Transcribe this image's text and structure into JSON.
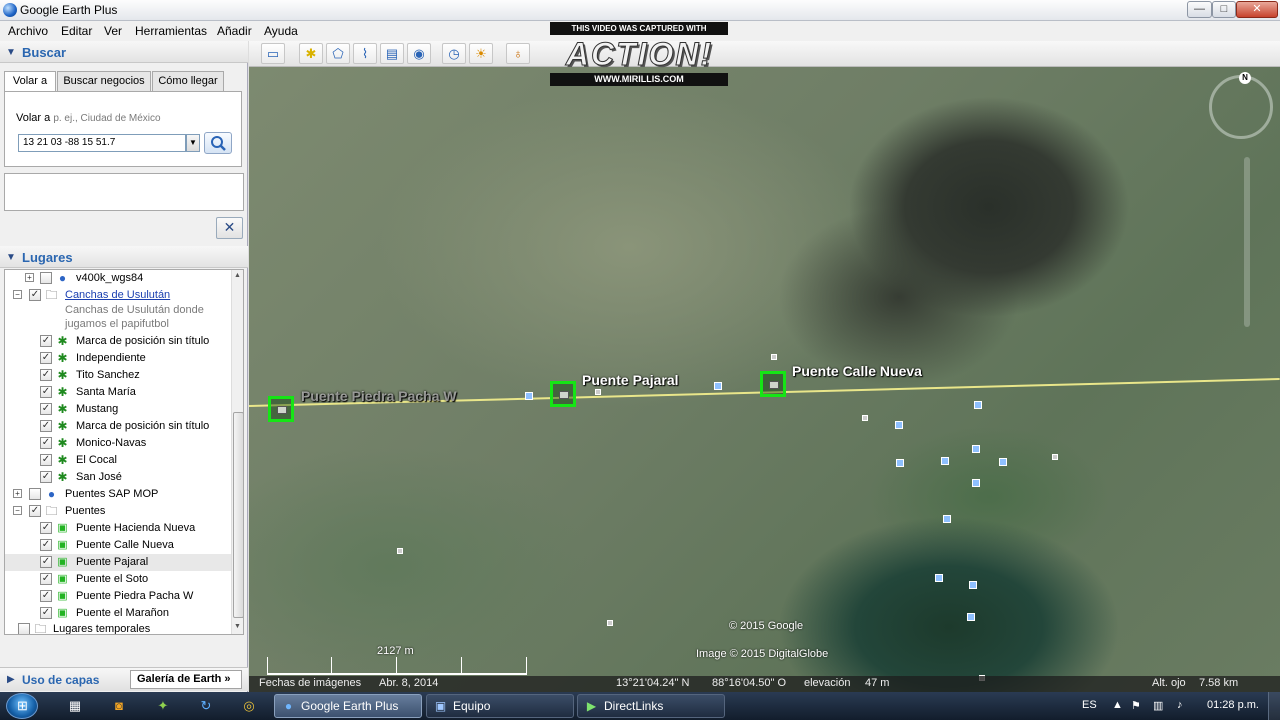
{
  "window": {
    "title": "Google Earth Plus",
    "buttons": {
      "minimize": "—",
      "maximize": "□",
      "close": "✕"
    }
  },
  "menu": [
    "Archivo",
    "Editar",
    "Ver",
    "Herramientas",
    "Añadir",
    "Ayuda"
  ],
  "search_panel": {
    "header": "Buscar",
    "tabs": [
      "Volar a",
      "Buscar negocios",
      "Cómo llegar"
    ],
    "fly_to_label": "Volar a",
    "placeholder_hint": "p. ej., Ciudad de México",
    "query_value": "13 21 03 -88 15 51.7",
    "close_label": "✕"
  },
  "places_panel": {
    "header": "Lugares",
    "items": [
      {
        "label": "v400k_wgs84",
        "icon": "globe-icon",
        "checked": false,
        "expander": "+",
        "indent": 1
      },
      {
        "label": "Canchas de Usulután",
        "icon": "folder-icon",
        "checked": true,
        "expander": "-",
        "indent": 0,
        "link": true
      },
      {
        "label": "Marca de posición sin título",
        "icon": "placemark-icon",
        "checked": true,
        "indent": 2
      },
      {
        "label": "Independiente",
        "icon": "placemark-icon",
        "checked": true,
        "indent": 2
      },
      {
        "label": "Tito Sanchez",
        "icon": "placemark-icon",
        "checked": true,
        "indent": 2
      },
      {
        "label": "Santa María",
        "icon": "placemark-icon",
        "checked": true,
        "indent": 2
      },
      {
        "label": "Mustang",
        "icon": "placemark-icon",
        "checked": true,
        "indent": 2
      },
      {
        "label": "Marca de posición sin título",
        "icon": "placemark-icon",
        "checked": true,
        "indent": 2
      },
      {
        "label": "Monico-Navas",
        "icon": "placemark-icon",
        "checked": true,
        "indent": 2
      },
      {
        "label": "El Cocal",
        "icon": "placemark-icon",
        "checked": true,
        "indent": 2
      },
      {
        "label": "San José",
        "icon": "placemark-icon",
        "checked": true,
        "indent": 2
      },
      {
        "label": "Puentes SAP MOP",
        "icon": "globe-icon",
        "checked": false,
        "expander": "+",
        "indent": 0
      },
      {
        "label": "Puentes",
        "icon": "folder-icon",
        "checked": true,
        "expander": "-",
        "indent": 0
      },
      {
        "label": "Puente Hacienda Nueva",
        "icon": "bridge-icon",
        "checked": true,
        "indent": 2
      },
      {
        "label": "Puente Calle Nueva",
        "icon": "bridge-icon",
        "checked": true,
        "indent": 2
      },
      {
        "label": "Puente Pajaral",
        "icon": "bridge-icon",
        "checked": true,
        "indent": 2,
        "selected": true
      },
      {
        "label": "Puente el Soto",
        "icon": "bridge-icon",
        "checked": true,
        "indent": 2
      },
      {
        "label": "Puente Piedra Pacha W",
        "icon": "bridge-icon",
        "checked": true,
        "indent": 2
      },
      {
        "label": "Puente el Marañon",
        "icon": "bridge-icon",
        "checked": true,
        "indent": 2
      },
      {
        "label": "Lugares temporales",
        "icon": "folder-icon",
        "checked": false,
        "indent": 0
      }
    ],
    "folder_description": "Canchas de Usulután donde jugamos el papifutbol"
  },
  "bottom": {
    "layers_label": "Uso de capas",
    "gallery_label": "Galería de Earth »"
  },
  "map": {
    "labels": {
      "pajaral": "Puente Pajaral",
      "calle_nueva": "Puente Calle Nueva",
      "piedra_pacha": "Puente Piedra Pacha W"
    },
    "copyright_google": "© 2015 Google",
    "copyright_imagery": "Image © 2015 DigitalGlobe",
    "scale_label": "2127 m",
    "compass_n": "N"
  },
  "watermark": {
    "caption": "THIS VIDEO WAS CAPTURED WITH",
    "logo": "ACTION!",
    "url": "WWW.MIRILLIS.COM"
  },
  "status": {
    "imagery_date_label": "Fechas de imágenes",
    "imagery_date": "Abr.  8, 2014",
    "latitude": "13°21'04.24\" N",
    "longitude": "88°16'04.50\" O",
    "elevation_label": "elevación",
    "elevation": "47 m",
    "eye_alt_label": "Alt. ojo",
    "eye_alt": "7.58 km"
  },
  "taskbar": {
    "tasks": [
      "Google Earth Plus",
      "Equipo",
      "DirectLinks"
    ],
    "language": "ES",
    "clock": "01:28 p.m."
  }
}
